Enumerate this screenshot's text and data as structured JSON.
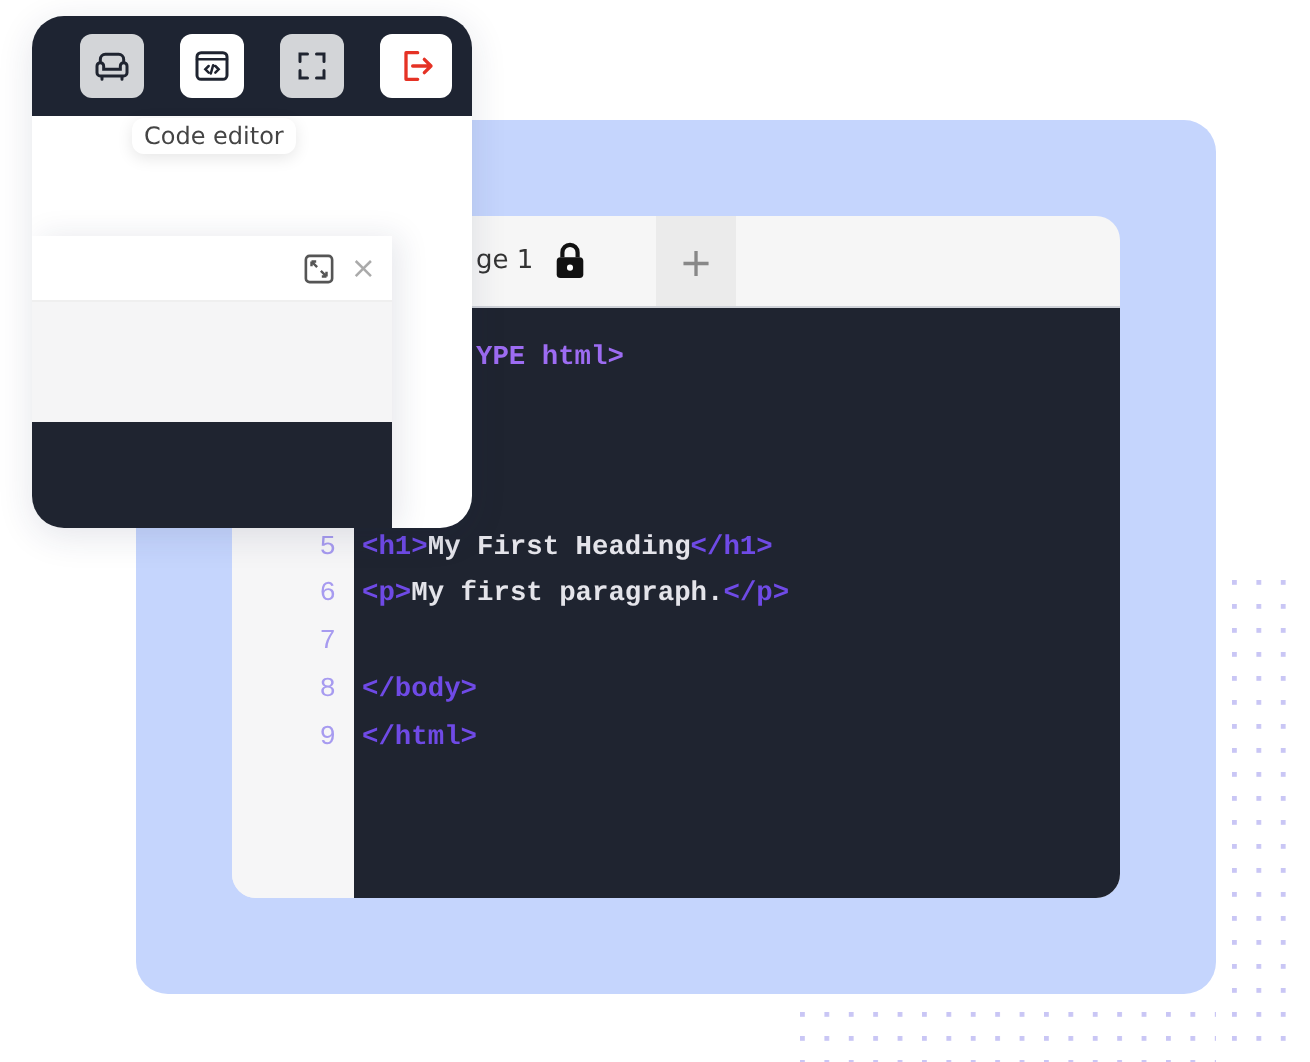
{
  "editor": {
    "tab": {
      "label": "ge 1",
      "locked": true
    },
    "new_tab": "+",
    "lines": [
      {
        "segments": [
          {
            "kind": "doctype",
            "text": "YPE html>"
          }
        ]
      },
      {
        "number": "5",
        "segments": [
          {
            "kind": "tag",
            "text": "<h1>"
          },
          {
            "kind": "text",
            "text": "My First Heading"
          },
          {
            "kind": "tag",
            "text": "</h1>"
          }
        ]
      },
      {
        "number": "6",
        "segments": [
          {
            "kind": "tag",
            "text": "<p>"
          },
          {
            "kind": "text",
            "text": "My first paragraph."
          },
          {
            "kind": "tag",
            "text": "</p>"
          }
        ]
      },
      {
        "number": "7"
      },
      {
        "number": "8",
        "segments": [
          {
            "kind": "tag",
            "text": "</body>"
          }
        ]
      },
      {
        "number": "9",
        "segments": [
          {
            "kind": "tag",
            "text": "</html>"
          }
        ]
      }
    ]
  },
  "popup": {
    "toolbar": [
      {
        "kind": "sofa",
        "selected": true
      },
      {
        "kind": "code",
        "selected": false
      },
      {
        "kind": "fullscreen",
        "selected": true
      },
      {
        "kind": "exit",
        "selected": false
      }
    ],
    "tooltip": "Code editor",
    "panel": {
      "close": "×"
    }
  }
}
